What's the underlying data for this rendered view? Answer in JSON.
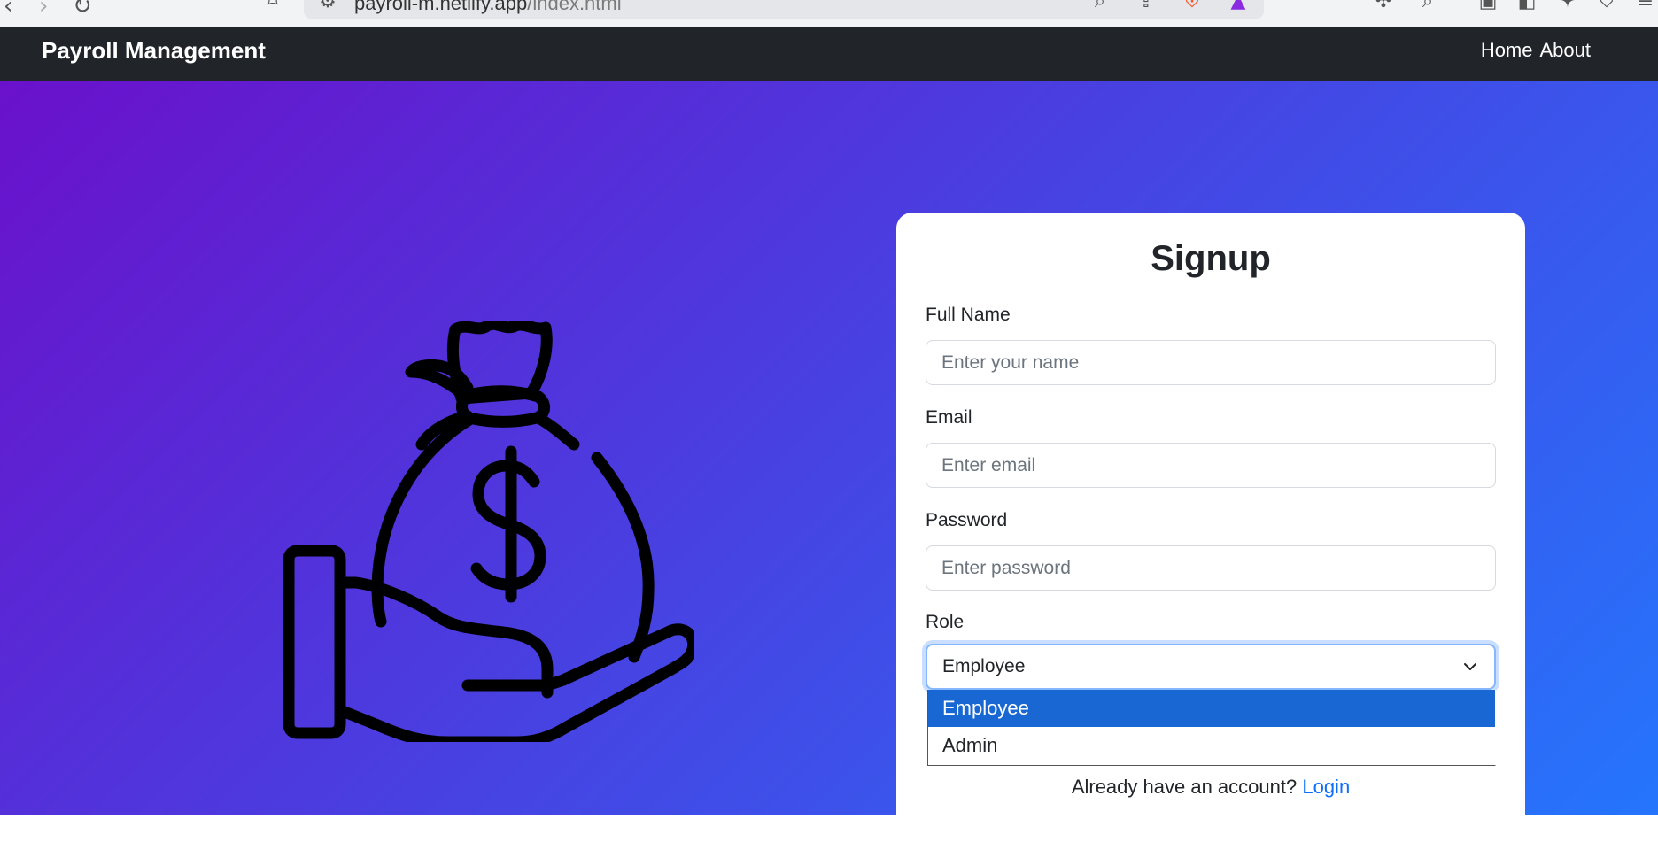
{
  "browser": {
    "url_host": "payroll-m.netlify.app",
    "url_path": "/index.html"
  },
  "navbar": {
    "brand": "Payroll Management",
    "links": [
      "Home",
      "About"
    ]
  },
  "illustration": {
    "icon": "money-bag-on-hand-icon",
    "symbol": "$"
  },
  "signup": {
    "title": "Signup",
    "fields": [
      {
        "label": "Full Name",
        "placeholder": "Enter your name"
      },
      {
        "label": "Email",
        "placeholder": "Enter email"
      },
      {
        "label": "Password",
        "placeholder": "Enter password"
      }
    ],
    "role": {
      "label": "Role",
      "selected": "Employee",
      "options": [
        "Employee",
        "Admin"
      ]
    },
    "footer_text": "Already have an account?",
    "login_link": "Login"
  },
  "colors": {
    "navbar_bg": "#212529",
    "gradient_start": "#6a11cb",
    "gradient_end": "#2575fc",
    "link": "#0d6efd",
    "option_highlight": "#1967d2"
  }
}
